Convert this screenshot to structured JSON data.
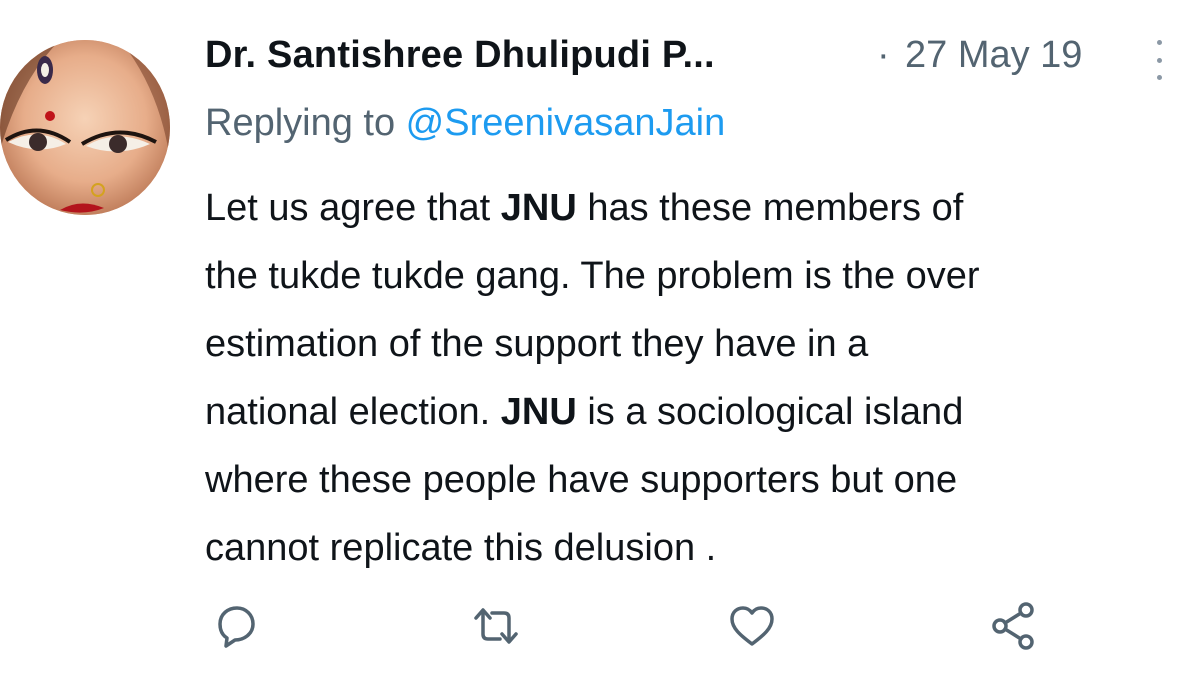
{
  "tweet": {
    "author_name": "Dr. Santishree Dhulipudi P...",
    "separator": "·",
    "date": "27 May 19",
    "replying_prefix": "Replying to ",
    "replying_handle": "@SreenivasanJain",
    "body_lines": [
      [
        {
          "t": "Let us agree that "
        },
        {
          "t": "JNU",
          "b": true
        },
        {
          "t": " has these members of"
        }
      ],
      [
        {
          "t": "the tukde tukde gang. The problem is the over"
        }
      ],
      [
        {
          "t": "estimation of the support they have in a"
        }
      ],
      [
        {
          "t": "national election. "
        },
        {
          "t": "JNU",
          "b": true
        },
        {
          "t": " is a sociological island"
        }
      ],
      [
        {
          "t": "where these people have supporters but one"
        }
      ],
      [
        {
          "t": "cannot replicate this delusion ."
        }
      ]
    ]
  },
  "actions": {
    "icons": [
      "reply-icon",
      "retweet-icon",
      "like-icon",
      "share-icon"
    ]
  },
  "colors": {
    "text": "#0f1419",
    "secondary": "#536471",
    "link": "#1d9bf0",
    "icon": "#536471"
  }
}
